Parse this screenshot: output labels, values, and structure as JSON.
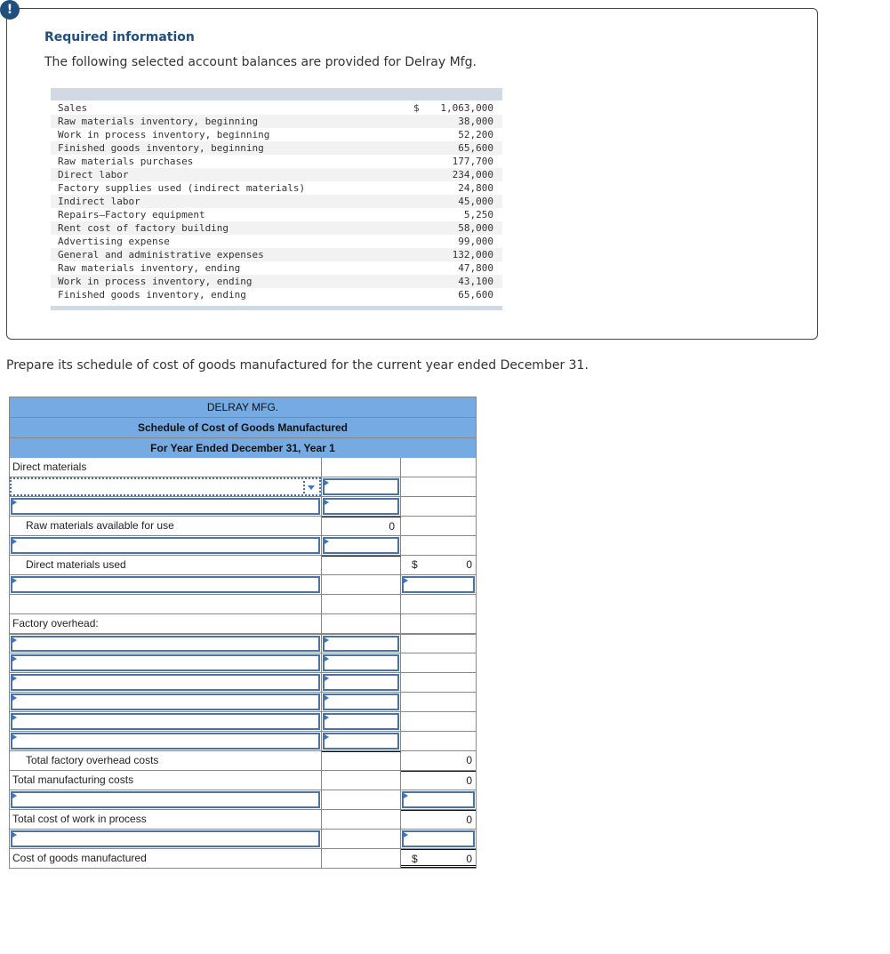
{
  "alert_badge": "!",
  "info": {
    "title": "Required information",
    "text": "The following selected account balances are provided for Delray Mfg.",
    "balances": [
      {
        "label": "Sales",
        "currency": "$",
        "value": "1,063,000"
      },
      {
        "label": "Raw materials inventory, beginning",
        "currency": "",
        "value": "38,000"
      },
      {
        "label": "Work in process inventory, beginning",
        "currency": "",
        "value": "52,200"
      },
      {
        "label": "Finished goods inventory, beginning",
        "currency": "",
        "value": "65,600"
      },
      {
        "label": "Raw materials purchases",
        "currency": "",
        "value": "177,700"
      },
      {
        "label": "Direct labor",
        "currency": "",
        "value": "234,000"
      },
      {
        "label": "Factory supplies used (indirect materials)",
        "currency": "",
        "value": "24,800"
      },
      {
        "label": "Indirect labor",
        "currency": "",
        "value": "45,000"
      },
      {
        "label": "Repairs—Factory equipment",
        "currency": "",
        "value": "5,250"
      },
      {
        "label": "Rent cost of factory building",
        "currency": "",
        "value": "58,000"
      },
      {
        "label": "Advertising expense",
        "currency": "",
        "value": "99,000"
      },
      {
        "label": "General and administrative expenses",
        "currency": "",
        "value": "132,000"
      },
      {
        "label": "Raw materials inventory, ending",
        "currency": "",
        "value": "47,800"
      },
      {
        "label": "Work in process inventory, ending",
        "currency": "",
        "value": "43,100"
      },
      {
        "label": "Finished goods inventory, ending",
        "currency": "",
        "value": "65,600"
      }
    ]
  },
  "prompt": "Prepare its schedule of cost of goods manufactured for the current year ended December 31.",
  "schedule": {
    "company": "DELRAY MFG.",
    "title": "Schedule of Cost of Goods Manufactured",
    "period": "For Year Ended December 31, Year 1",
    "labels": {
      "direct_materials": "Direct materials",
      "raw_available": "Raw materials available for use",
      "dm_used": "Direct materials used",
      "factory_overhead": "Factory overhead:",
      "total_overhead": "Total factory overhead costs",
      "total_mfg": "Total manufacturing costs",
      "total_wip": "Total cost of work in process",
      "cogm": "Cost of goods manufactured"
    },
    "values": {
      "raw_available": "0",
      "dm_used_currency": "$",
      "dm_used": "0",
      "total_overhead": "0",
      "total_mfg": "0",
      "total_wip": "0",
      "cogm_currency": "$",
      "cogm": "0"
    }
  }
}
